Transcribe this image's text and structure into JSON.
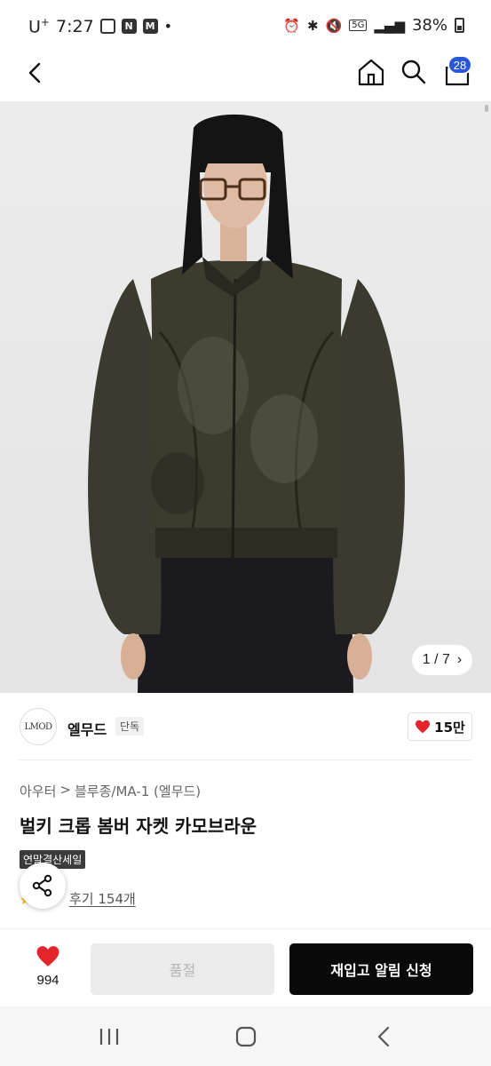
{
  "status_bar": {
    "carrier": "U",
    "carrier_sup": "+",
    "time": "7:27",
    "icons_left": [
      "image-icon",
      "naver-icon",
      "m-icon"
    ],
    "naver_letter": "N",
    "m_letter": "M",
    "dot": "•",
    "network": "5G",
    "battery": "38%"
  },
  "nav": {
    "cart_count": "28"
  },
  "image": {
    "counter_current": "1 / 7",
    "counter_arrow": "›"
  },
  "brand": {
    "logo_text": "LMOD",
    "name": "엘무드",
    "tag": "단독",
    "likes": "15만"
  },
  "product": {
    "breadcrumb": [
      "아우터",
      ">",
      "블루종/MA-1 (엘무드)"
    ],
    "title": "벌키 크롭 봄버 자켓 카모브라운",
    "sale_badge": "연말결산세일",
    "rating_partial": "★",
    "reviews": "후기 154개"
  },
  "actions": {
    "wish_count": "994",
    "soldout_label": "품절",
    "restock_label": "재입고 알림 신청"
  },
  "colors": {
    "accent": "#2a56d8",
    "heart": "#e5252c",
    "primary_button": "#0a0a0a"
  }
}
